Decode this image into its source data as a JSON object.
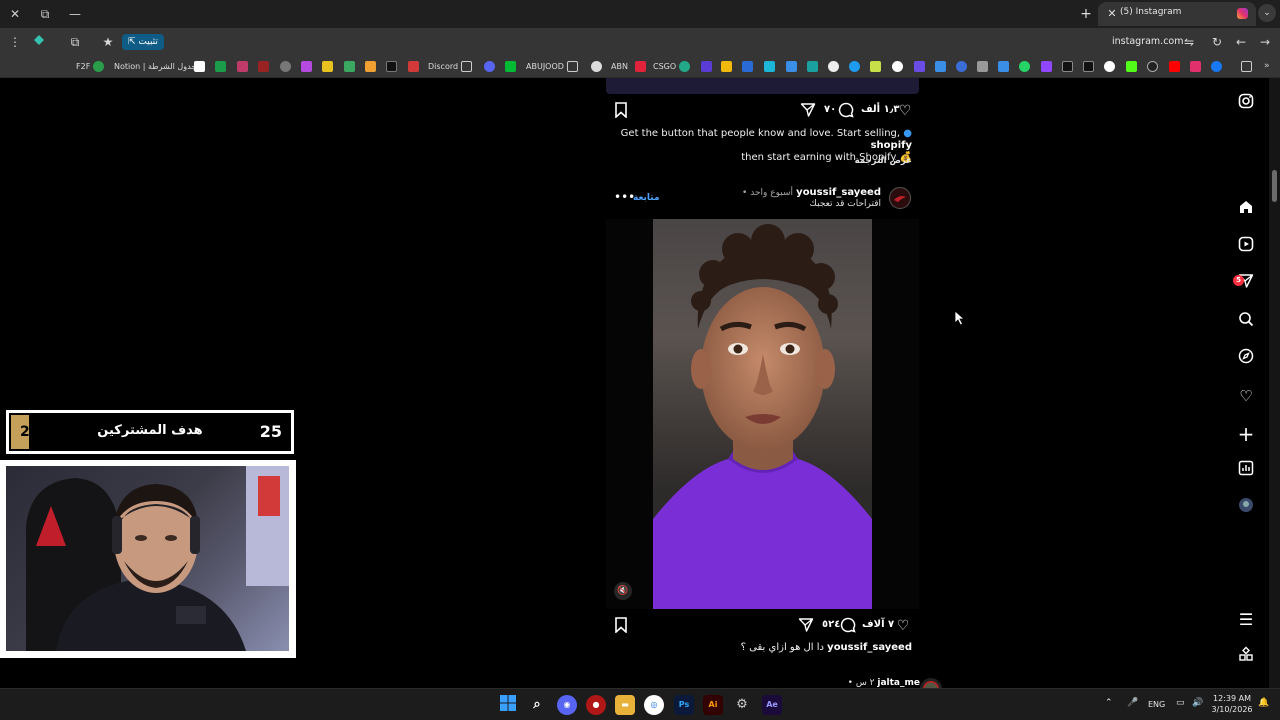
{
  "browser": {
    "tab_title": "(5) Instagram",
    "url": "instagram.com",
    "install_chip": "تثبيت",
    "window_close": "✕",
    "window_restore": "⧉",
    "window_minimize": "—",
    "new_tab": "+",
    "tab_close": "✕"
  },
  "bookmarks": {
    "f2f": "F2F",
    "notion": "Notion | جدول الشرطة",
    "discord": "Discord",
    "abujood": "ABUJOOD",
    "abn": "ABN",
    "csgo": "CSGO"
  },
  "post_prev": {
    "likes": "١٫٣ ألف",
    "comments": "٧٠",
    "caption_user": "shopify",
    "caption_line1": "Get the button that people know and love. Start selling,",
    "caption_line2": "then start earning with Shopify 💰",
    "translate": "عرض الترجمة"
  },
  "post": {
    "username": "youssif_sayeed",
    "time": "• أسبوع واحد",
    "subtitle": "اقتراحات قد تعجبك",
    "follow": "متابعة",
    "more": "•••",
    "likes": "٧ آلاف",
    "comments": "٥٢٤",
    "comment_user": "youssif_sayeed",
    "comment_text": "دا ال هو ازاي بقى ؟"
  },
  "next_post": {
    "username": "jalta_me",
    "time": "• ٢ س"
  },
  "nav": {
    "notification_count": "5"
  },
  "overlay": {
    "goal_current": "2",
    "goal_label": "هدف المشتركين",
    "goal_target": "25"
  },
  "taskbar": {
    "lang": "ENG",
    "time": "12:39 AM",
    "date": "3/10/2026"
  },
  "colors": {
    "accent_follow": "#4da3ff",
    "badge": "#ff3040",
    "shirt": "#7a2fd6"
  }
}
